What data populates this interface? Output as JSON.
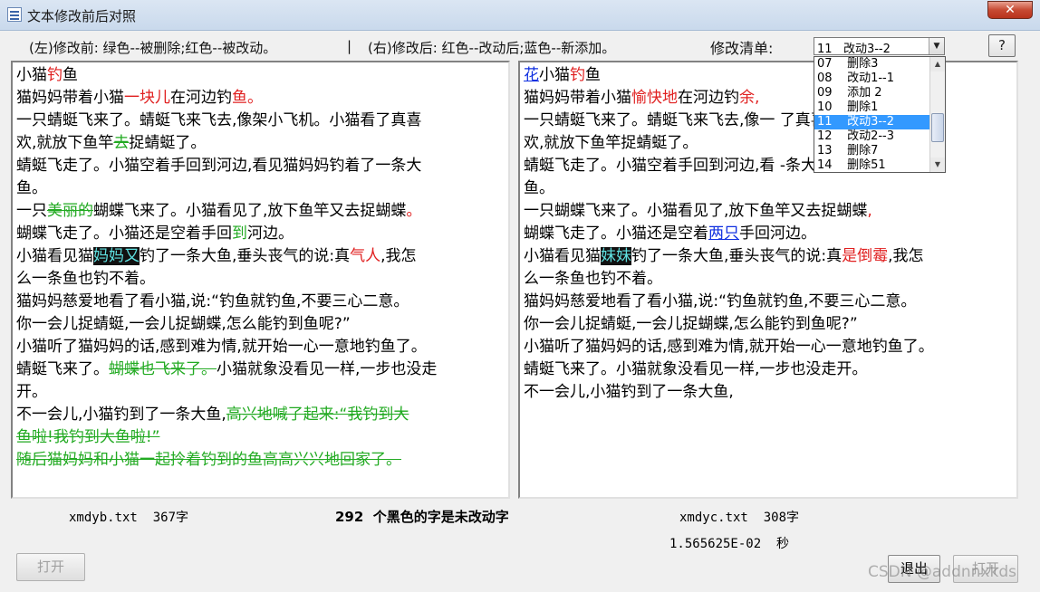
{
  "window": {
    "title": "文本修改前后对照",
    "close_label": "✕"
  },
  "legend": {
    "left": "(左)修改前:  绿色--被删除;红色--被改动。",
    "separator": "|",
    "right": "(右)修改后:  红色--改动后;蓝色--新添加。"
  },
  "revision": {
    "label": "修改清单:",
    "selected": "11   改动3--2",
    "items": [
      "07    删除3",
      "08    改动1--1",
      "09    添加 2",
      "10    删除1",
      "11    改动3--2",
      "12    改动2--3",
      "13    删除7",
      "14    删除51"
    ],
    "selected_index": 4
  },
  "help_label": "?",
  "left_lines": [
    [
      [
        "小猫",
        ""
      ],
      [
        "钓",
        "chg"
      ],
      [
        "鱼",
        ""
      ]
    ],
    [
      [
        "猫妈妈带着小猫",
        ""
      ],
      [
        "一块儿",
        "chg"
      ],
      [
        "在河边钓",
        ""
      ],
      [
        "鱼。",
        "chg"
      ]
    ],
    [
      [
        "一只蜻蜓飞来了。蜻蜓飞来飞去,像架小飞机。小猫看了真喜",
        ""
      ]
    ],
    [
      [
        "欢,就放下鱼竿",
        ""
      ],
      [
        "去",
        "del"
      ],
      [
        "捉蜻蜓了。",
        ""
      ]
    ],
    [
      [
        "蜻蜓飞走了。小猫空着手回到河边,看见猫妈妈钓着了一条大",
        ""
      ]
    ],
    [
      [
        "鱼。",
        ""
      ]
    ],
    [
      [
        "一只",
        ""
      ],
      [
        "美丽的",
        "del"
      ],
      [
        "蝴蝶飞来了。小猫看见了,放下鱼竿又去捉蝴蝶",
        ""
      ],
      [
        "。",
        "chg"
      ]
    ],
    [
      [
        "蝴蝶飞走了。小猫还是空着手回",
        ""
      ],
      [
        "到",
        "dchg"
      ],
      [
        "河边。",
        ""
      ]
    ],
    [
      [
        "小猫看见猫",
        ""
      ],
      [
        "妈妈又",
        "hl"
      ],
      [
        "钓了一条大鱼,垂头丧气的说:真",
        ""
      ],
      [
        "气人",
        "chg"
      ],
      [
        ",我怎",
        ""
      ]
    ],
    [
      [
        "么一条鱼也钓不着。",
        ""
      ]
    ],
    [
      [
        "猫妈妈慈爱地看了看小猫,说:“钓鱼就钓鱼,不要三心二意。",
        ""
      ]
    ],
    [
      [
        "你一会儿捉蜻蜓,一会儿捉蝴蝶,怎么能钓到鱼呢?”",
        ""
      ]
    ],
    [
      [
        "小猫听了猫妈妈的话,感到难为情,就开始一心一意地钓鱼了。",
        ""
      ]
    ],
    [
      [
        "蜻蜓飞来了。",
        ""
      ],
      [
        "蝴蝶也飞来了。",
        "del"
      ],
      [
        "小猫就象没看见一样,一步也没走",
        ""
      ]
    ],
    [
      [
        "开。",
        ""
      ]
    ],
    [
      [
        "不一会儿,小猫钓到了一条大鱼,",
        ""
      ],
      [
        "高兴地喊了起来:“我钓到大",
        "del"
      ]
    ],
    [
      [
        "鱼啦!我钓到大鱼啦!”",
        "del"
      ]
    ],
    [
      [
        "随后猫妈妈和小猫一起拎着钓到的鱼高高兴兴地回家了。",
        "del"
      ]
    ]
  ],
  "right_lines": [
    [
      [
        "花",
        "add"
      ],
      [
        "小猫",
        ""
      ],
      [
        "钓",
        "chg"
      ],
      [
        "鱼",
        ""
      ]
    ],
    [
      [
        "猫妈妈带着小猫",
        ""
      ],
      [
        "愉快地",
        "chg"
      ],
      [
        "在河边钓",
        ""
      ],
      [
        "余,",
        "chg"
      ]
    ],
    [
      [
        "一只蜻蜓飞来了。蜻蜓飞来飞去,像一",
        ""
      ],
      [
        "         ",
        ""
      ],
      [
        "了真喜",
        ""
      ]
    ],
    [
      [
        "欢,就放下鱼竿捉蜻蜓了。",
        ""
      ]
    ],
    [
      [
        "蜻蜓飞走了。小猫空着手回到河边,看",
        ""
      ],
      [
        "         ",
        ""
      ],
      [
        "-条大",
        ""
      ]
    ],
    [
      [
        "鱼。",
        ""
      ]
    ],
    [
      [
        "一只蝴蝶飞来了。小猫看见了,放下鱼竿又去捉蝴蝶",
        ""
      ],
      [
        ",",
        "chg"
      ]
    ],
    [
      [
        "蝴蝶飞走了。小猫还是空着",
        ""
      ],
      [
        "两只",
        "add"
      ],
      [
        "手回河边。",
        ""
      ]
    ],
    [
      [
        "小猫看见猫",
        ""
      ],
      [
        "妹妹",
        "hl"
      ],
      [
        "钓了一条大鱼,垂头丧气的说:真",
        ""
      ],
      [
        "是倒霉",
        "chg"
      ],
      [
        ",我怎",
        ""
      ]
    ],
    [
      [
        "么一条鱼也钓不着。",
        ""
      ]
    ],
    [
      [
        "猫妈妈慈爱地看了看小猫,说:“钓鱼就钓鱼,不要三心二意。",
        ""
      ]
    ],
    [
      [
        "你一会儿捉蜻蜓,一会儿捉蝴蝶,怎么能钓到鱼呢?”",
        ""
      ]
    ],
    [
      [
        "小猫听了猫妈妈的话,感到难为情,就开始一心一意地钓鱼了。",
        ""
      ]
    ],
    [
      [
        "蜻蜓飞来了。小猫就象没看见一样,一步也没走开。",
        ""
      ]
    ],
    [
      [
        "不一会儿,小猫钓到了一条大鱼,",
        ""
      ]
    ]
  ],
  "status": {
    "left_file": "xmdyb.txt  367字",
    "summary": "292  个黑色的字是未改动字",
    "right_file": "xmdyc.txt  308字",
    "time": "1.565625E-02  秒"
  },
  "buttons": {
    "open_left": "打开",
    "exit": "退出",
    "open_right": "打开"
  },
  "watermark": "CSDN @addnnxkds"
}
